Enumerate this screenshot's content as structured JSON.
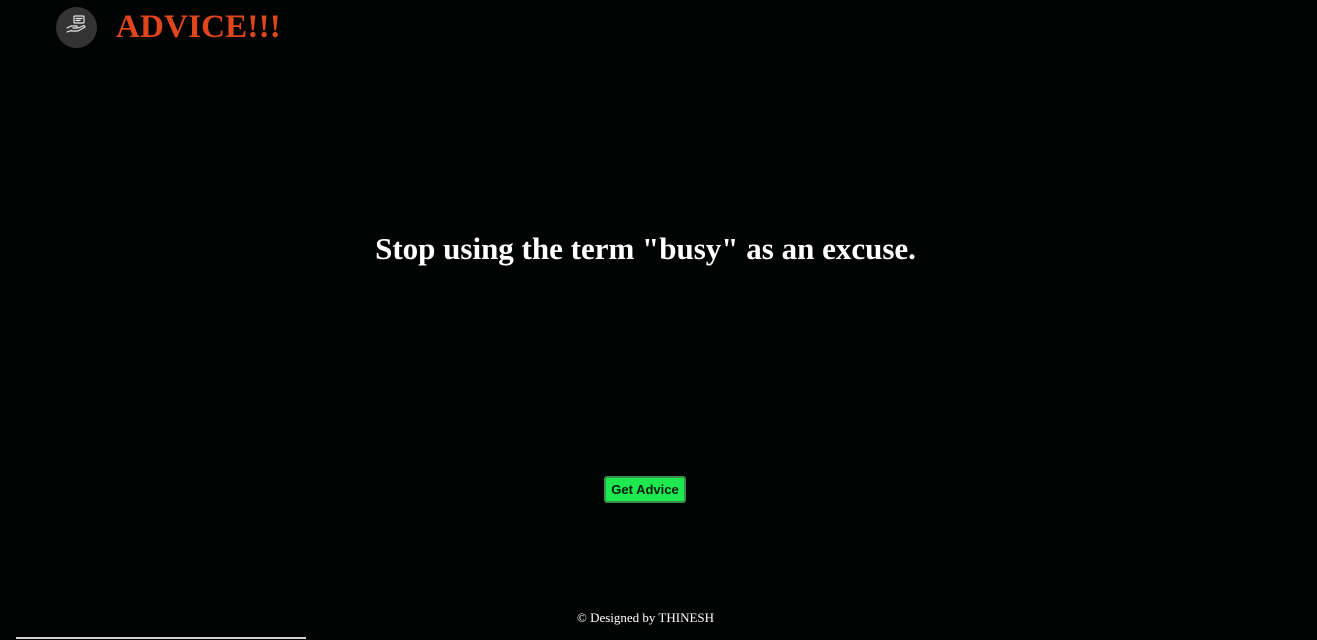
{
  "header": {
    "logo_icon": "hand-holding-message-icon",
    "title": "ADVICE!!!",
    "title_color": "#e0461c"
  },
  "main": {
    "advice_text": "Stop using the term \"busy\" as an excuse.",
    "button_label": "Get Advice",
    "button_color": "#1ee84f"
  },
  "footer": {
    "credit": "© Designed by THINESH"
  },
  "colors": {
    "background": "#020403",
    "text": "#ffffff"
  }
}
